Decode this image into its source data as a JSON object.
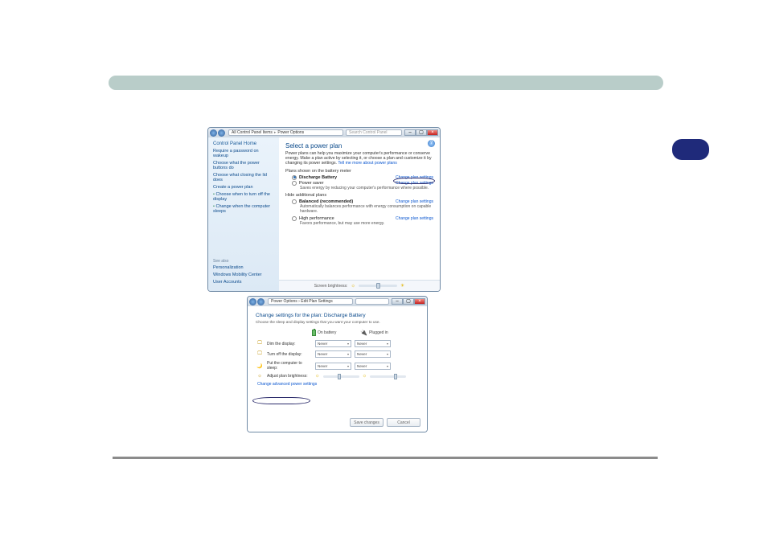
{
  "win1": {
    "address": {
      "root": "All Control Panel Items",
      "leaf": "Power Options"
    },
    "search_placeholder": "Search Control Panel",
    "winctrls": {
      "min": "–",
      "max": "▢",
      "close": "×"
    },
    "sidebar": {
      "home": "Control Panel Home",
      "links": [
        "Require a password on wakeup",
        "Choose what the power buttons do",
        "Choose what closing the lid does",
        "Create a power plan",
        "Choose when to turn off the display",
        "Change when the computer sleeps"
      ],
      "see_also_label": "See also",
      "see_also": [
        "Personalization",
        "Windows Mobility Center",
        "User Accounts"
      ]
    },
    "main": {
      "title": "Select a power plan",
      "intro": "Power plans can help you maximize your computer's performance or conserve energy. Make a plan active by selecting it, or choose a plan and customize it by changing its power settings.",
      "intro_link": "Tell me more about power plans",
      "shown_label": "Plans shown on the battery meter",
      "hide_label": "Hide additional plans",
      "plans": [
        {
          "name": "Discharge Battery",
          "desc": "",
          "selected": true,
          "change": "Change plan settings"
        },
        {
          "name": "Power saver",
          "desc": "Saves energy by reducing your computer's performance where possible.",
          "selected": false,
          "change": "Change plan settings"
        },
        {
          "name": "Balanced (recommended)",
          "desc": "Automatically balances performance with energy consumption on capable hardware.",
          "selected": false,
          "change": "Change plan settings"
        },
        {
          "name": "High performance",
          "desc": "Favors performance, but may use more energy.",
          "selected": false,
          "change": "Change plan settings"
        }
      ],
      "brightness_label": "Screen brightness:",
      "help_glyph": "?"
    }
  },
  "win2": {
    "address": "Power Options › Edit Plan Settings",
    "search_placeholder": "",
    "title": "Change settings for the plan: Discharge Battery",
    "subtitle": "Choose the sleep and display settings that you want your computer to use.",
    "col_battery": "On battery",
    "col_plugged": "Plugged in",
    "rows": [
      {
        "icon": "🖵",
        "label": "Dim the display:",
        "batt": "Never",
        "plug": "Never"
      },
      {
        "icon": "🖵",
        "label": "Turn off the display:",
        "batt": "Never",
        "plug": "Never"
      },
      {
        "icon": "🌙",
        "label": "Put the computer to sleep:",
        "batt": "Never",
        "plug": "Never"
      }
    ],
    "bright_row": {
      "icon": "☼",
      "label": "Adjust plan brightness:"
    },
    "advanced_link": "Change advanced power settings",
    "buttons": {
      "save": "Save changes",
      "cancel": "Cancel"
    }
  },
  "chart_data": null
}
